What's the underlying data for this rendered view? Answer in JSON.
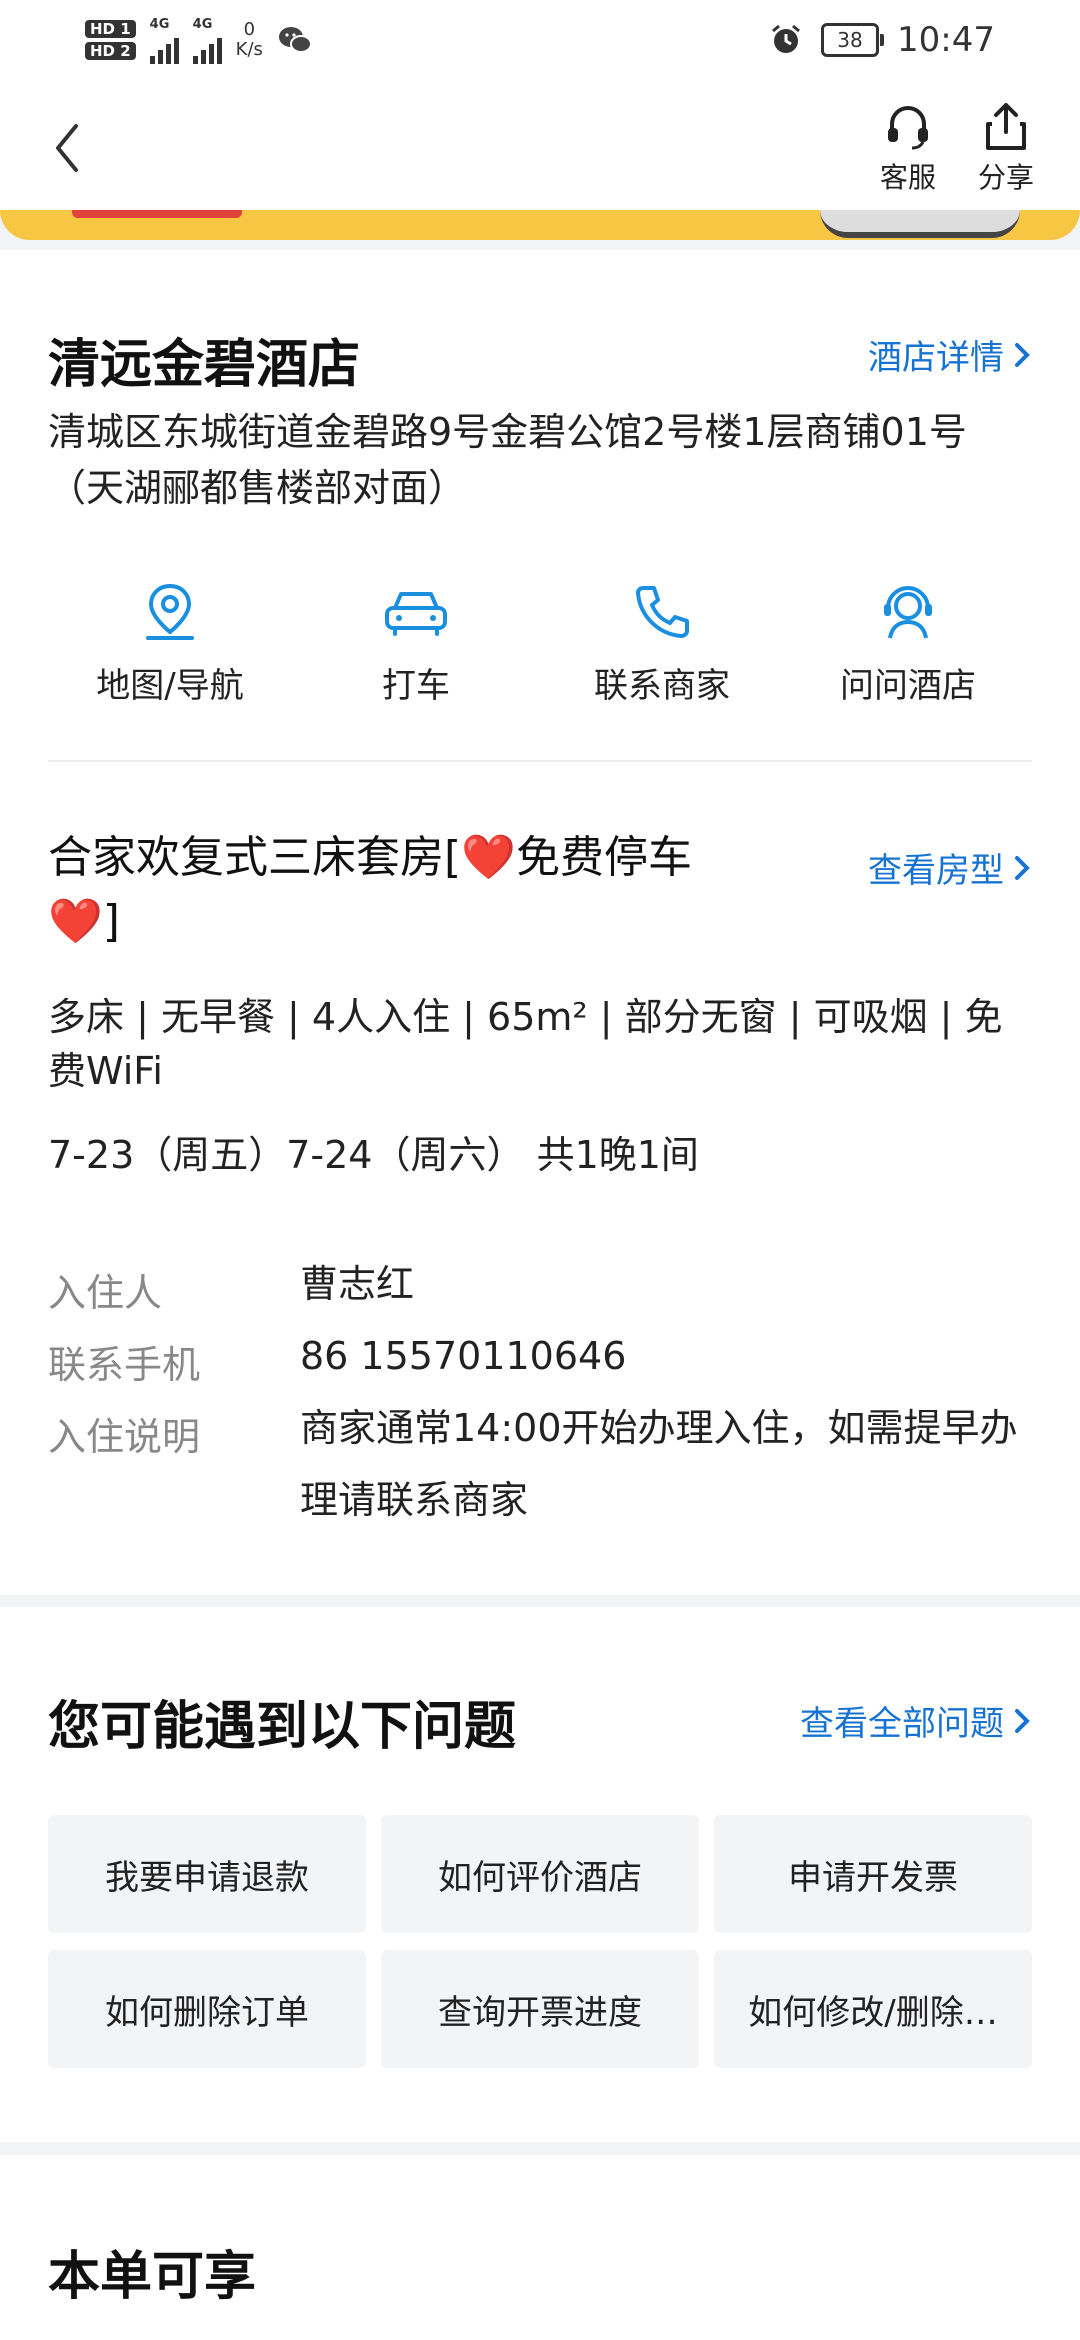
{
  "status_bar": {
    "hd1": "HD 1",
    "hd2": "HD 2",
    "net_type1": "4G",
    "net_type2": "4G",
    "net_speed_value": "0",
    "net_speed_unit": "K/s",
    "battery": "38",
    "time": "10:47"
  },
  "header": {
    "service_label": "客服",
    "share_label": "分享"
  },
  "hotel": {
    "name": "清远金碧酒店",
    "details_link": "酒店详情",
    "address": "清城区东城街道金碧路9号金碧公馆2号楼1层商铺01号（天湖郦都售楼部对面）",
    "actions": [
      {
        "label": "地图/导航",
        "icon": "map-pin-icon"
      },
      {
        "label": "打车",
        "icon": "car-icon"
      },
      {
        "label": "联系商家",
        "icon": "phone-icon"
      },
      {
        "label": "问问酒店",
        "icon": "headset-agent-icon"
      }
    ]
  },
  "room": {
    "title": "合家欢复式三床套房[❤️免费停车❤️]",
    "view_link": "查看房型",
    "info": "多床 | 无早餐 | 4人入住 | 65m² | 部分无窗 | 可吸烟 | 免费WiFi",
    "dates": "7-23（周五）7-24（周六） 共1晚1间"
  },
  "guest": {
    "guest_label": "入住人",
    "guest_value": "曹志红",
    "phone_label": "联系手机",
    "phone_value": "86 15570110646",
    "note_label": "入住说明",
    "note_value": "商家通常14:00开始办理入住，如需提早办理请联系商家"
  },
  "faq": {
    "title": "您可能遇到以下问题",
    "all_link": "查看全部问题",
    "items": [
      "我要申请退款",
      "如何评价酒店",
      "申请开发票",
      "如何删除订单",
      "查询开票进度",
      "如何修改/删除…"
    ]
  },
  "enjoy": {
    "title": "本单可享"
  },
  "colors": {
    "accent": "#1673d1",
    "icon_blue": "#1a8fe0",
    "banner_yellow": "#f7c744"
  }
}
